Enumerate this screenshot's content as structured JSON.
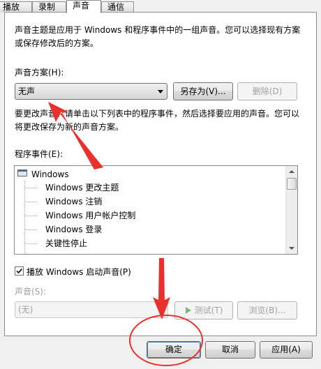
{
  "tabs": [
    {
      "label": "播放"
    },
    {
      "label": "录制"
    },
    {
      "label": "声音"
    },
    {
      "label": "通信"
    }
  ],
  "active_tab": 2,
  "description": "声音主题是应用于 Windows 和程序事件中的一组声音。您可以选择现有方案或保存修改后的方案。",
  "scheme_label": "声音方案(H):",
  "scheme_value": "无声",
  "save_as_label": "另存为(V)...",
  "delete_label": "删除(D)",
  "instruction": "要更改声音，请单击以下列表中的程序事件，然后选择要应用的声音。您可以将更改保存为新的声音方案。",
  "events_label": "程序事件(E):",
  "events": {
    "root": "Windows",
    "items": [
      "Windows 更改主题",
      "Windows 注销",
      "Windows 用户帐户控制",
      "Windows 登录",
      "关键性停止"
    ]
  },
  "startup_sound": {
    "label": "播放 Windows 启动声音(P)",
    "checked": true
  },
  "sound_label": "声音(S):",
  "sound_value": "(无)",
  "test_label": "测试(T)",
  "browse_label": "浏览(B)...",
  "footer": {
    "ok": "确定",
    "cancel": "取消",
    "apply": "应用(A)"
  },
  "colors": {
    "annotation": "#e8312c",
    "focus": "#3c7fb1"
  }
}
